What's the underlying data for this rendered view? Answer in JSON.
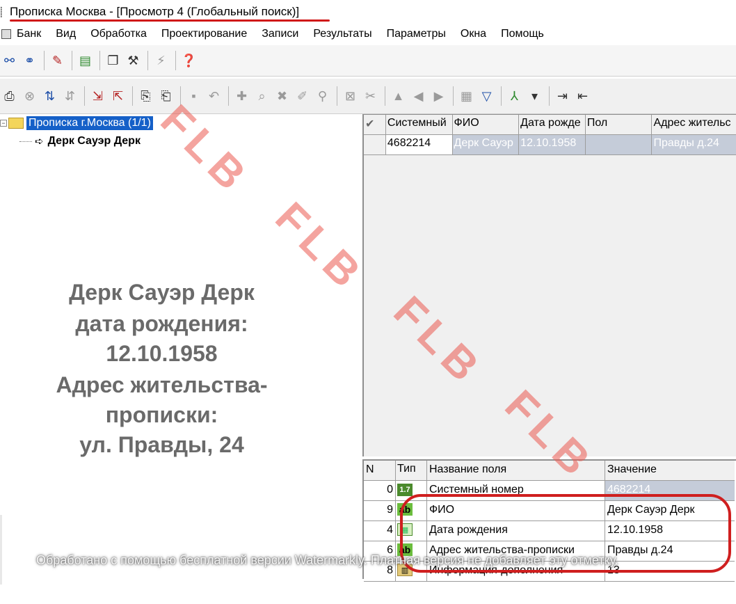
{
  "window": {
    "title": "Прописка Москва - [Просмотр 4 (Глобальный поиск)]",
    "icon": "app-icon"
  },
  "menu": [
    "Банк",
    "Вид",
    "Обработка",
    "Проектирование",
    "Записи",
    "Результаты",
    "Параметры",
    "Окна",
    "Помощь"
  ],
  "tree": {
    "root_label": "Прописка г.Москва (1/1)",
    "child_label": "Дерк Сауэр Дерк"
  },
  "annotation": {
    "lines": [
      "Дерк Сауэр Дерк",
      "дата рождения:",
      "12.10.1958",
      "Адрес жительства-",
      "прописки:",
      "ул. Правды, 24"
    ]
  },
  "records_grid": {
    "columns": [
      "Системный",
      "ФИО",
      "Дата рожде",
      "Пол",
      "Адрес жительс"
    ],
    "row": {
      "system": "4682214",
      "fio": "Дерк Сауэр",
      "birth": "12.10.1958",
      "gender": "",
      "address": "Правды д.24"
    }
  },
  "fields_grid": {
    "columns": {
      "n": "N",
      "type": "Тип",
      "name": "Название поля",
      "value": "Значение"
    },
    "rows": [
      {
        "n": "0",
        "type": "1.7",
        "name": "Системный номер",
        "value": "4682214"
      },
      {
        "n": "9",
        "type": "ab",
        "name": "ФИО",
        "value": "Дерк Сауэр Дерк"
      },
      {
        "n": "4",
        "type": "date",
        "name": "Дата рождения",
        "value": "12.10.1958"
      },
      {
        "n": "6",
        "type": "ab",
        "name": "Адрес жительства-прописки",
        "value": "Правды д.24"
      },
      {
        "n": "8",
        "type": "book",
        "name": "Информация-дополнения",
        "value": "13"
      }
    ]
  },
  "watermark": {
    "text": "FLB"
  },
  "footer_note": "Обработано с помощью бесплатной версии Watermarkly. Платная версия не добавляет эту отметку.",
  "colors": {
    "selection": "#1560c8",
    "highlight_red": "#cf1f1f",
    "watermark": "#eb5a50"
  }
}
